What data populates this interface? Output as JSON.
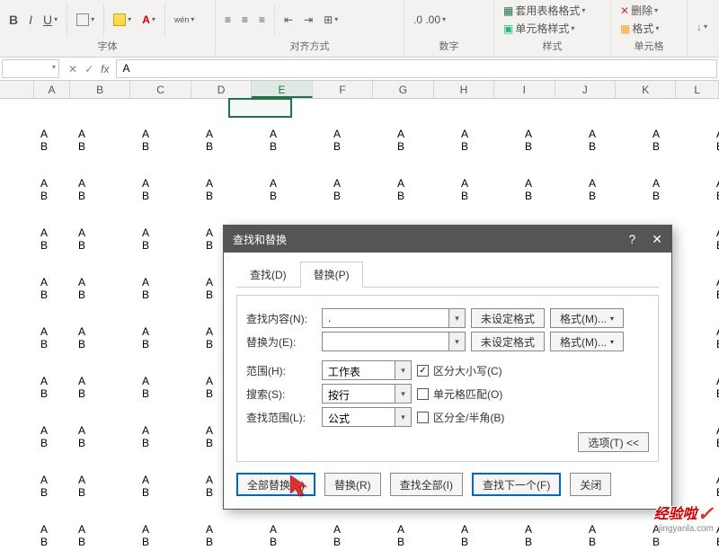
{
  "ribbon": {
    "font": {
      "bold": "B",
      "italic": "I",
      "underline": "U",
      "ruby": "wén",
      "label": "字体"
    },
    "align": {
      "label": "对齐方式"
    },
    "number": {
      "label": "数字"
    },
    "styles": {
      "cond_fmt": "套用表格格式",
      "cell_style": "单元格样式",
      "label": "样式"
    },
    "cells": {
      "delete": "删除",
      "format": "格式",
      "label": "单元格"
    }
  },
  "formula_bar": {
    "name_box": "",
    "fx": "fx",
    "value": "A"
  },
  "columns": [
    "A",
    "B",
    "C",
    "D",
    "E",
    "F",
    "G",
    "H",
    "I",
    "J",
    "K",
    "L"
  ],
  "cell_value": "A\nB",
  "dialog": {
    "title": "查找和替换",
    "help": "?",
    "close": "✕",
    "tab_find": "查找(D)",
    "tab_replace": "替换(P)",
    "find_label": "查找内容(N):",
    "replace_label": "替换为(E):",
    "no_format": "未设定格式",
    "format_btn": "格式(M)...",
    "scope_label": "范围(H):",
    "scope_val": "工作表",
    "search_label": "搜索(S):",
    "search_val": "按行",
    "lookin_label": "查找范围(L):",
    "lookin_val": "公式",
    "chk_case": "区分大小写(C)",
    "chk_whole": "单元格匹配(O)",
    "chk_width": "区分全/半角(B)",
    "options_btn": "选项(T) <<",
    "btn_replace_all": "全部替换(A)",
    "btn_replace": "替换(R)",
    "btn_find_all": "查找全部(I)",
    "btn_find_next": "查找下一个(F)",
    "btn_close": "关闭"
  },
  "watermark": {
    "big": "经验啦",
    "small": "jingyanla.com"
  }
}
